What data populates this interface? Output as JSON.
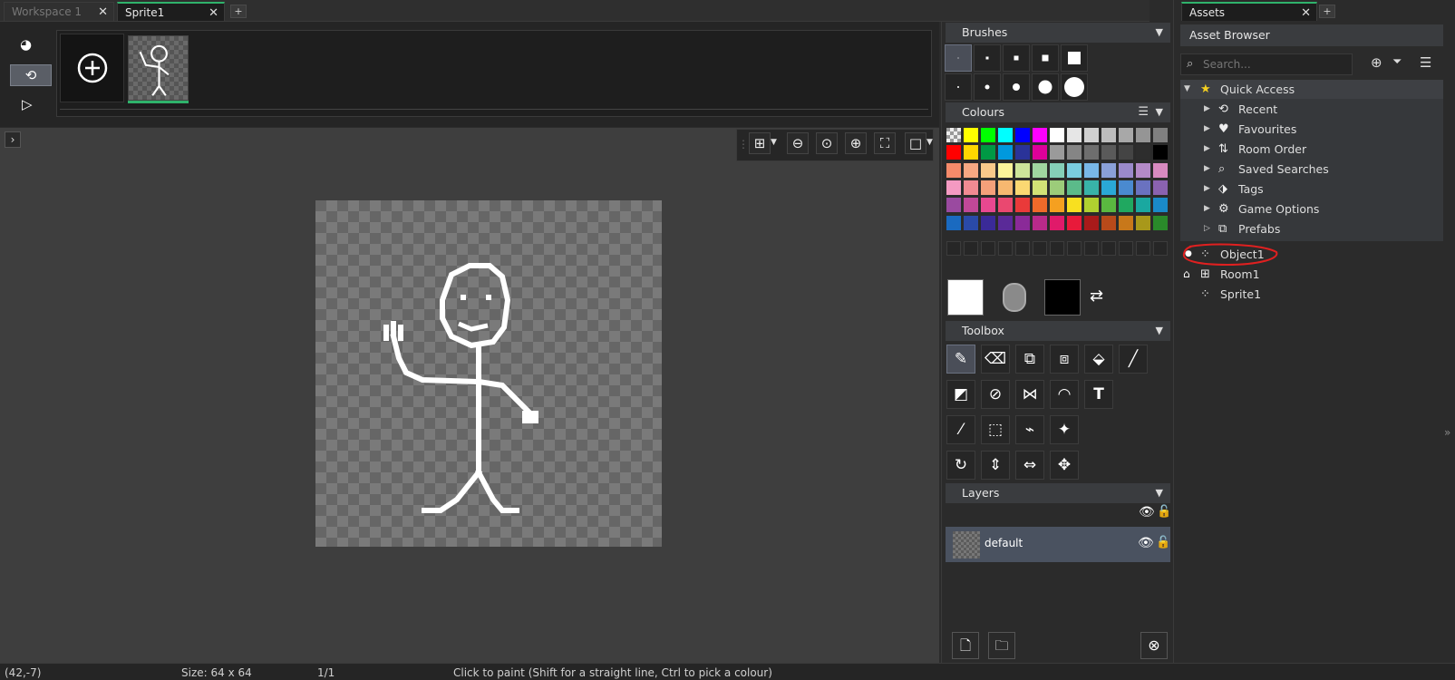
{
  "tabs": {
    "workspace": "Workspace 1",
    "sprite": "Sprite1",
    "assets": "Assets"
  },
  "frame_strip": {
    "frame_count": 1
  },
  "panels": {
    "brushes": "Brushes",
    "colours": "Colours",
    "toolbox": "Toolbox",
    "layers": "Layers"
  },
  "layers": [
    {
      "name": "default"
    }
  ],
  "palette": [
    [
      "#bfbfbf",
      "#ffff00",
      "#00ff00",
      "#00ffff",
      "#0000ff",
      "#ff00ff",
      "#ffffff",
      "#e6e6e6",
      "#d0d0d0",
      "#bdbdbd",
      "#a8a8a8",
      "#959595",
      "#808080"
    ],
    [
      "#ff0000",
      "#ffd700",
      "#009944",
      "#0099dd",
      "#2a3399",
      "#dd0099",
      "#9a9a9a",
      "#858585",
      "#6e6e6e",
      "#5a5a5a",
      "#444444",
      "#2d2d2d",
      "#000000"
    ],
    [
      "#f58a6a",
      "#f7a882",
      "#f9c98a",
      "#fbf49a",
      "#cde59a",
      "#a0d6a0",
      "#85cfb8",
      "#7acde0",
      "#79b8e8",
      "#8aa0d8",
      "#9b8acb",
      "#b48ac8",
      "#d88ac0"
    ],
    [
      "#f49ac2",
      "#f18a92",
      "#f5a07a",
      "#f7b870",
      "#fad872",
      "#d2e276",
      "#9ccc7a",
      "#5bbb8a",
      "#38b3a8",
      "#2aa8d6",
      "#4a8ad0",
      "#6a72c0",
      "#8a62b0"
    ],
    [
      "#9a4aa0",
      "#c04898",
      "#e84890",
      "#ea4870",
      "#ea3a3a",
      "#ef6a2a",
      "#f5a020",
      "#f8e020",
      "#b0d030",
      "#5ab840",
      "#20a860",
      "#1aa8a0",
      "#1a8ac8"
    ],
    [
      "#1a6ac0",
      "#2a4aa8",
      "#3a2a98",
      "#5a2a98",
      "#8a2a98",
      "#b82a8a",
      "#e01a6a",
      "#e81a3a",
      "#a81a1a",
      "#b84a1a",
      "#c8781a",
      "#a8981a",
      "#2a8a2a"
    ]
  ],
  "assets": {
    "browser_title": "Asset Browser",
    "search_placeholder": "Search...",
    "quick_access": "Quick Access",
    "quick_items": [
      "Recent",
      "Favourites",
      "Room Order",
      "Saved Searches",
      "Tags",
      "Game Options",
      "Prefabs"
    ],
    "resources": [
      "Object1",
      "Room1",
      "Sprite1"
    ]
  },
  "status": {
    "coords": "(42,-7)",
    "size": "Size: 64 x 64",
    "frame": "1/1",
    "hint": "Click to paint (Shift for a straight line, Ctrl to pick a colour)"
  },
  "colors": {
    "accent": "#2fb36b",
    "annotation": "#e02020"
  }
}
